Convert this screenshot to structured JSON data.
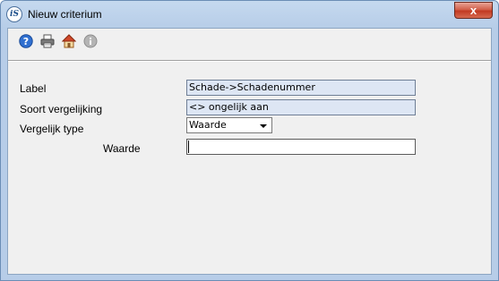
{
  "window": {
    "title": "Nieuw criterium",
    "app_icon_text": "iS",
    "close_label": "x"
  },
  "toolbar": [
    {
      "icon": "help-icon"
    },
    {
      "icon": "print-icon"
    },
    {
      "icon": "home-icon"
    },
    {
      "icon": "info-icon"
    }
  ],
  "form": {
    "label": {
      "caption": "Label",
      "value": "Schade->Schadenummer"
    },
    "soort": {
      "caption": "Soort vergelijking",
      "value": "<> ongelijk aan"
    },
    "type": {
      "caption": "Vergelijk type",
      "selected": "Waarde"
    },
    "waarde": {
      "caption": "Waarde",
      "value": ""
    }
  },
  "colors": {
    "field_readonly": "#dde6f4",
    "close_button": "#c13a22",
    "client_bg": "#f0f0f0"
  }
}
